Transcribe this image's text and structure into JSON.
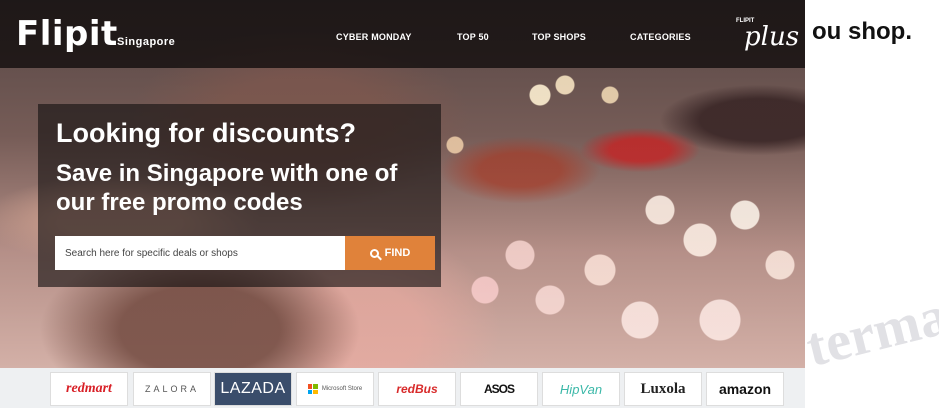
{
  "header": {
    "logo": "Flipit",
    "logo_sub": "Singapore",
    "nav": [
      "CYBER MONDAY",
      "TOP 50",
      "TOP SHOPS",
      "CATEGORIES"
    ],
    "plus_small": "FLIPIT",
    "plus": "plus"
  },
  "side_text": "ou shop.",
  "promo": {
    "heading": "Looking for discounts?",
    "subheading": "Save in Singapore with one of our free promo codes",
    "search_placeholder": "Search here for specific deals or shops",
    "find_label": "FIND"
  },
  "brands": [
    "redmart",
    "ZALORA",
    "LAZADA",
    "Microsoft Store",
    "redBus",
    "ASOS",
    "HipVan",
    "Luxola",
    "amazon"
  ],
  "watermark": "terma"
}
